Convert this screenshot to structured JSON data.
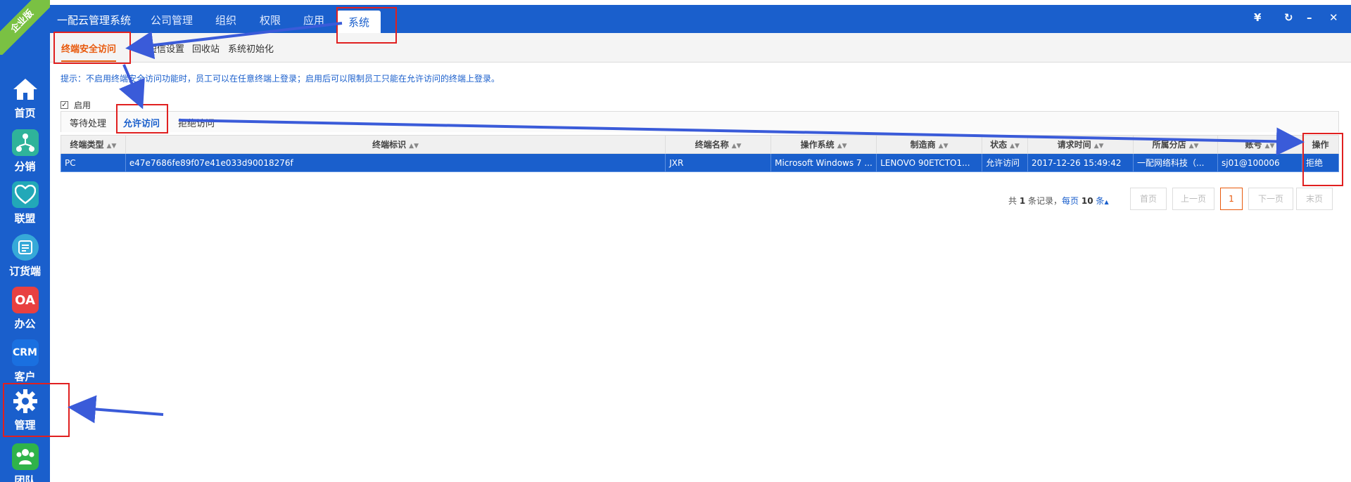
{
  "edition_badge": "企业版",
  "sidebar": {
    "items": [
      {
        "label": "首页",
        "icon": "home-icon"
      },
      {
        "label": "分销",
        "icon": "distribution-icon"
      },
      {
        "label": "联盟",
        "icon": "alliance-icon"
      },
      {
        "label": "订货端",
        "icon": "order-icon"
      },
      {
        "label": "办公",
        "icon": "oa-icon",
        "icon_text": "OA"
      },
      {
        "label": "客户",
        "icon": "crm-icon",
        "icon_text": "CRM"
      },
      {
        "label": "管理",
        "icon": "gear-icon"
      },
      {
        "label": "团队",
        "icon": "team-icon"
      }
    ]
  },
  "header": {
    "brand": "一配云管理系统",
    "tabs": [
      "公司管理",
      "组织",
      "权限",
      "应用",
      "系统"
    ],
    "active_tab": "系统",
    "tools": {
      "currency": "¥",
      "refresh": "↻",
      "minimize": "–",
      "close": "✕"
    }
  },
  "subnav": {
    "items": [
      "终端安全访问",
      "短信设置",
      "回收站",
      "系统初始化"
    ],
    "active": "终端安全访问"
  },
  "hint": "提示：不启用终端安全访问功能时，员工可以在任意终端上登录；启用后可以限制员工只能在允许访问的终端上登录。",
  "enable": {
    "label": "启用",
    "checked": true
  },
  "inner_tabs": {
    "items": [
      "等待处理",
      "允许访问",
      "拒绝访问"
    ],
    "active": "允许访问"
  },
  "table": {
    "columns": [
      "终端类型",
      "终端标识",
      "终端名称",
      "操作系统",
      "制造商",
      "状态",
      "请求时间",
      "所属分店",
      "账号",
      "操作"
    ],
    "rows": [
      [
        "PC",
        "e47e7686fe89f07e41e033d90018276f",
        "JXR",
        "Microsoft Windows 7 ...",
        "LENOVO 90ETCTO1...",
        "允许访问",
        "2017-12-26 15:49:42",
        "一配网络科技（...",
        "sj01@100006",
        "拒绝"
      ]
    ]
  },
  "pager": {
    "prefix": "共",
    "total": "1",
    "middle": "条记录，",
    "per_page_label": "每页",
    "per_page": "10",
    "suffix": "条",
    "buttons": [
      "首页",
      "上一页",
      "1",
      "下一页",
      "末页"
    ]
  },
  "colors": {
    "primary": "#1a5fcc",
    "accent": "#e8590c",
    "annotation": "#e02020",
    "arrow": "#3a5bd9",
    "badge": "#7ac143"
  }
}
